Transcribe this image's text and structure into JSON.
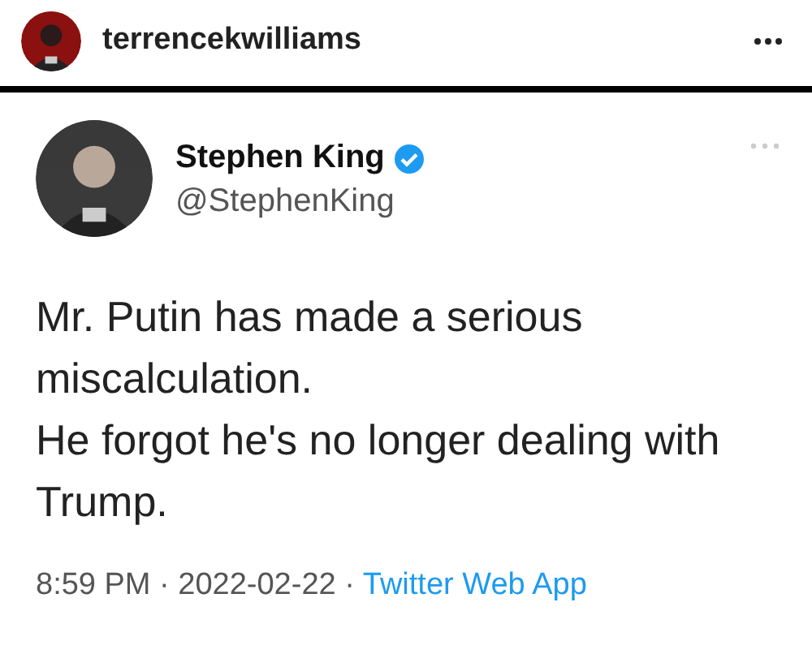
{
  "post": {
    "username": "terrencekwilliams"
  },
  "tweet": {
    "name": "Stephen King",
    "verified": true,
    "handle": "@StephenKing",
    "paragraphs": [
      "Mr. Putin has made a serious miscalculation.",
      "He forgot he's no longer dealing with Trump."
    ],
    "meta": "8:59 PM · 2022-02-22 ·",
    "source": "Twitter Web App"
  }
}
